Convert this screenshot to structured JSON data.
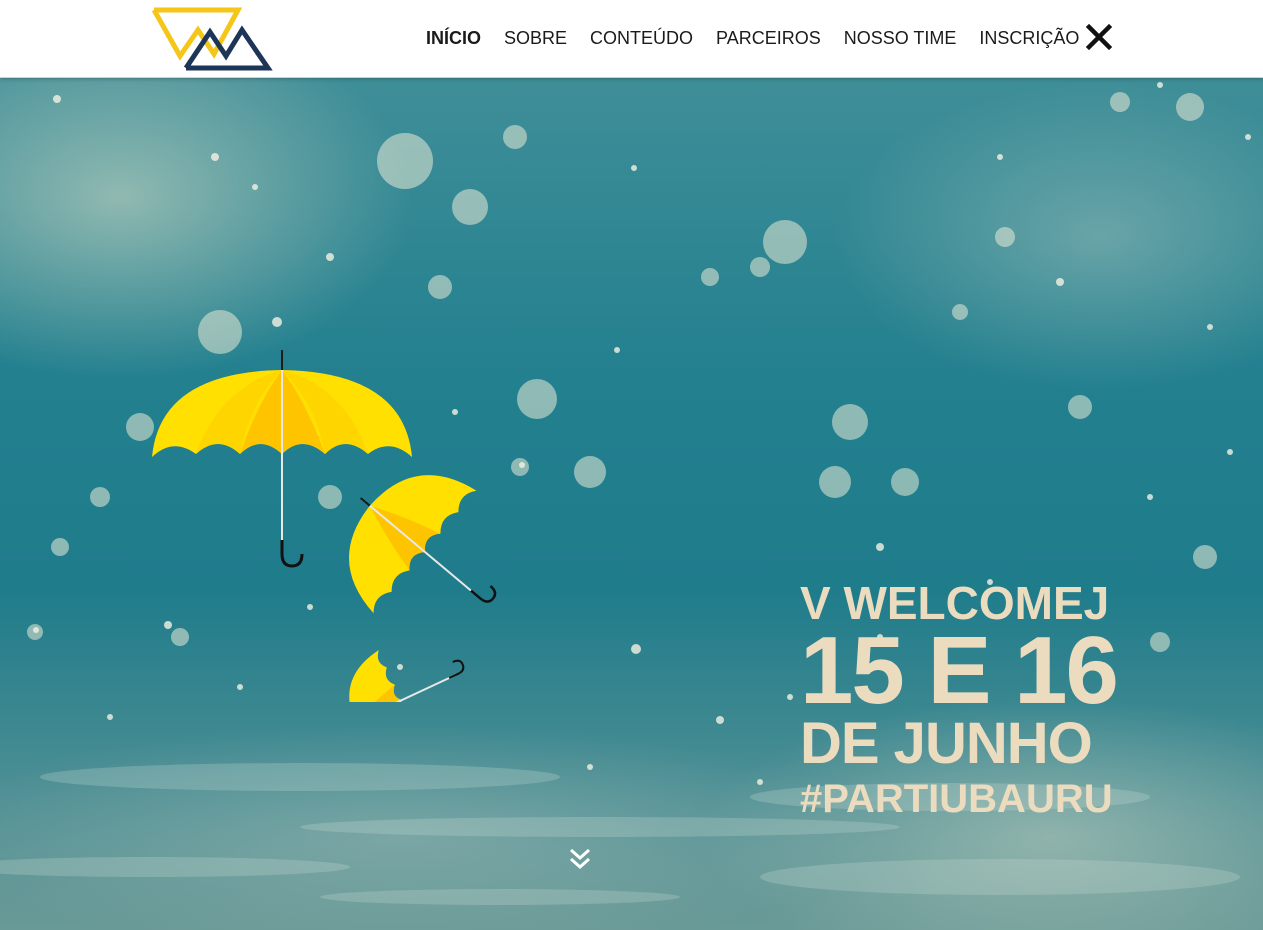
{
  "nav": {
    "items": [
      {
        "label": "INÍCIO",
        "active": true
      },
      {
        "label": "SOBRE",
        "active": false
      },
      {
        "label": "CONTEÚDO",
        "active": false
      },
      {
        "label": "PARCEIROS",
        "active": false
      },
      {
        "label": "NOSSO TIME",
        "active": false
      },
      {
        "label": "INSCRIÇÃO",
        "active": false
      }
    ],
    "close_icon": "close-icon",
    "logo_icon": "welcomej-logo-icon"
  },
  "hero": {
    "line1": "V WELCOMEJ",
    "line2": "15 E 16",
    "line3": "DE JUNHO",
    "line4": "#PARTIUBAURU",
    "scroll_icon": "chevrons-down-icon"
  },
  "colors": {
    "navbar_bg": "#ffffff",
    "logo_yellow": "#f5c518",
    "logo_navy": "#1d3557",
    "hero_text": "#ecdcbf",
    "umbrella_yellow": "#ffd400"
  }
}
